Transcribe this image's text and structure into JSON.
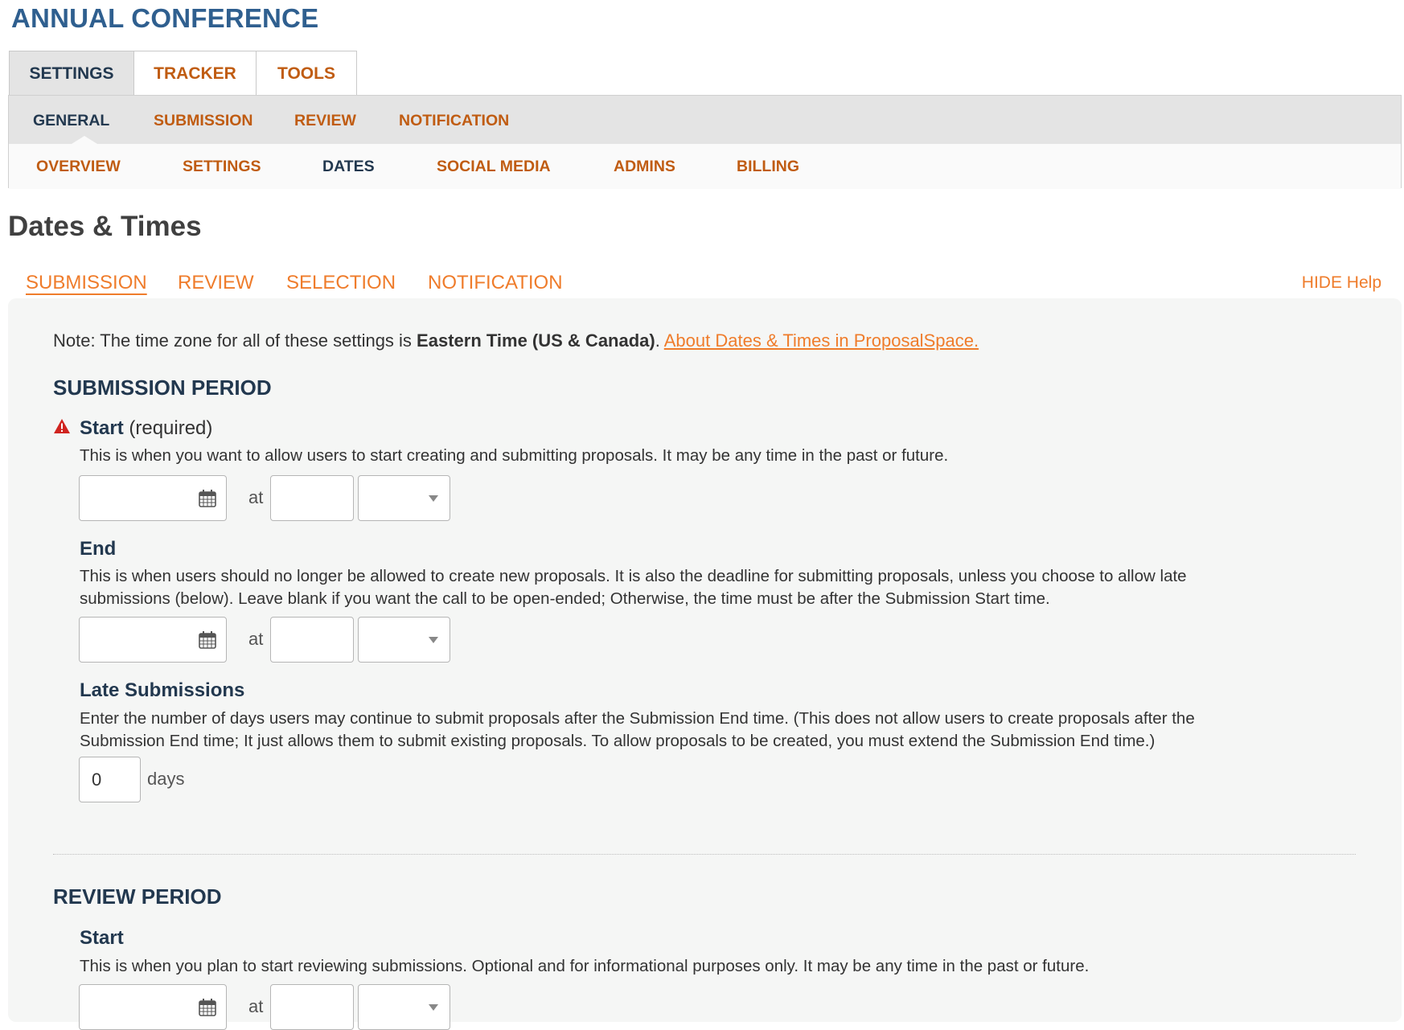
{
  "app": {
    "title": "ANNUAL CONFERENCE"
  },
  "main_tabs": [
    {
      "label": "SETTINGS",
      "active": true
    },
    {
      "label": "TRACKER",
      "active": false
    },
    {
      "label": "TOOLS",
      "active": false
    }
  ],
  "nav_row1": [
    {
      "label": "GENERAL",
      "active": true
    },
    {
      "label": "SUBMISSION",
      "active": false
    },
    {
      "label": "REVIEW",
      "active": false
    },
    {
      "label": "NOTIFICATION",
      "active": false
    }
  ],
  "nav_row2": [
    {
      "label": "OVERVIEW",
      "active": false
    },
    {
      "label": "SETTINGS",
      "active": false
    },
    {
      "label": "DATES",
      "active": true
    },
    {
      "label": "SOCIAL MEDIA",
      "active": false
    },
    {
      "label": "ADMINS",
      "active": false
    },
    {
      "label": "BILLING",
      "active": false
    }
  ],
  "page": {
    "heading": "Dates & Times"
  },
  "sub_tabs": [
    {
      "label": "SUBMISSION",
      "active": true
    },
    {
      "label": "REVIEW",
      "active": false
    },
    {
      "label": "SELECTION",
      "active": false
    },
    {
      "label": "NOTIFICATION",
      "active": false
    }
  ],
  "help": {
    "toggle_label": "HIDE Help"
  },
  "note": {
    "prefix": "Note: The time zone for all of these settings is ",
    "timezone": "Eastern Time (US & Canada)",
    "suffix": ". ",
    "link": "About Dates & Times in ProposalSpace."
  },
  "submission_period": {
    "title": "SUBMISSION PERIOD",
    "start": {
      "label": "Start",
      "required": "(required)",
      "description": "This is when you want to allow users to start creating and submitting proposals. It may be any time in the past or future.",
      "date_value": "",
      "time_value": "",
      "ampm_value": ""
    },
    "end": {
      "label": "End",
      "description_line1": "This is when users should no longer be allowed to create new proposals. It is also the deadline for submitting proposals, unless you choose to allow late",
      "description_line2": "submissions (below). Leave blank if you want the call to be open-ended; Otherwise, the time must be after the Submission Start time.",
      "date_value": "",
      "time_value": "",
      "ampm_value": ""
    },
    "late": {
      "label": "Late Submissions",
      "description_line1": "Enter the number of days users may continue to submit proposals after the Submission End time. (This does not allow users to create proposals after the",
      "description_line2": "Submission End time; It just allows them to submit existing proposals. To allow proposals to be created, you must extend the Submission End time.)",
      "days_value": "0",
      "days_unit": "days"
    }
  },
  "review_period": {
    "title": "REVIEW PERIOD",
    "start": {
      "label": "Start",
      "description": "This is when you plan to start reviewing submissions. Optional and for informational purposes only. It may be any time in the past or future."
    }
  },
  "common": {
    "at_label": "at"
  },
  "colors": {
    "brand_blue": "#2f5f8f",
    "dark_navy": "#22384f",
    "nav_orange": "#c05c12",
    "link_orange": "#ef7c2b",
    "warning_red": "#d0241f"
  }
}
